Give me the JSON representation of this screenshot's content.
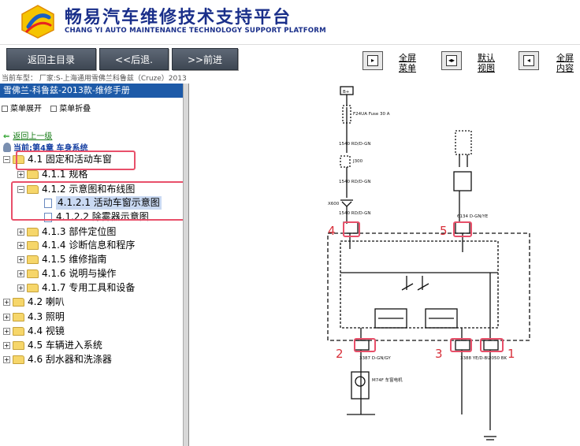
{
  "header": {
    "title": "畅易汽车维修技术支持平台",
    "subtitle": "CHANG YI AUTO MAINTENANCE TECHNOLOGY SUPPORT PLATFORM"
  },
  "toolbar": {
    "home": "返回主目录",
    "back": "<<后退.",
    "forward": ">>前进",
    "fullscreen_menu": [
      "全屏",
      "菜单"
    ],
    "default_view": [
      "默认",
      "视图"
    ],
    "fullscreen_content": [
      "全屏",
      "内容"
    ]
  },
  "breadcrumb": "当前车型：  厂家:S-上海通用雪佛兰科鲁兹（Cruze）2013",
  "panel": {
    "title": "雪佛兰-科鲁兹-2013款-维修手册",
    "expand": "菜单展开",
    "collapse": "菜单折叠",
    "back": "返回上一级",
    "current": "当前:第4章 车身系统",
    "tree": [
      {
        "label": "4.1 固定和活动车窗",
        "exp": "−"
      },
      {
        "label": "4.1.1 规格",
        "exp": "+"
      },
      {
        "label": "4.1.2 示意图和布线图",
        "exp": "−"
      },
      {
        "label": "4.1.2.1 活动车窗示意图",
        "exp": ""
      },
      {
        "label": "4.1.2.2 除雾器示意图",
        "exp": ""
      },
      {
        "label": "4.1.3 部件定位图",
        "exp": "+"
      },
      {
        "label": "4.1.4 诊断信息和程序",
        "exp": "+"
      },
      {
        "label": "4.1.5 维修指南",
        "exp": "+"
      },
      {
        "label": "4.1.6 说明与操作",
        "exp": "+"
      },
      {
        "label": "4.1.7 专用工具和设备",
        "exp": "+"
      },
      {
        "label": "4.2 喇叭",
        "exp": "+"
      },
      {
        "label": "4.3 照明",
        "exp": "+"
      },
      {
        "label": "4.4 视镜",
        "exp": "+"
      },
      {
        "label": "4.5 车辆进入系统",
        "exp": "+"
      },
      {
        "label": "4.6 刮水器和洗涤器",
        "exp": "+"
      }
    ]
  },
  "diagram": {
    "pins": [
      "4",
      "5",
      "2",
      "3",
      "1"
    ],
    "labels": {
      "bplus": "B+",
      "fuse": "F24UA Fuse 30 A",
      "wire1": "1540 RD/D-GN",
      "j300": "J300",
      "wire2": "1540 RD/D-GN",
      "x600": "X600",
      "wire3": "1540 RD/D-GN",
      "wire_right": "6134 D-GN/YE",
      "wire_b1": "3387 D-GN/GY",
      "wire_b2": "3388 YE/D-BU",
      "wire_b3": "2050 BK",
      "motor": "M74F 车窗电机"
    }
  }
}
